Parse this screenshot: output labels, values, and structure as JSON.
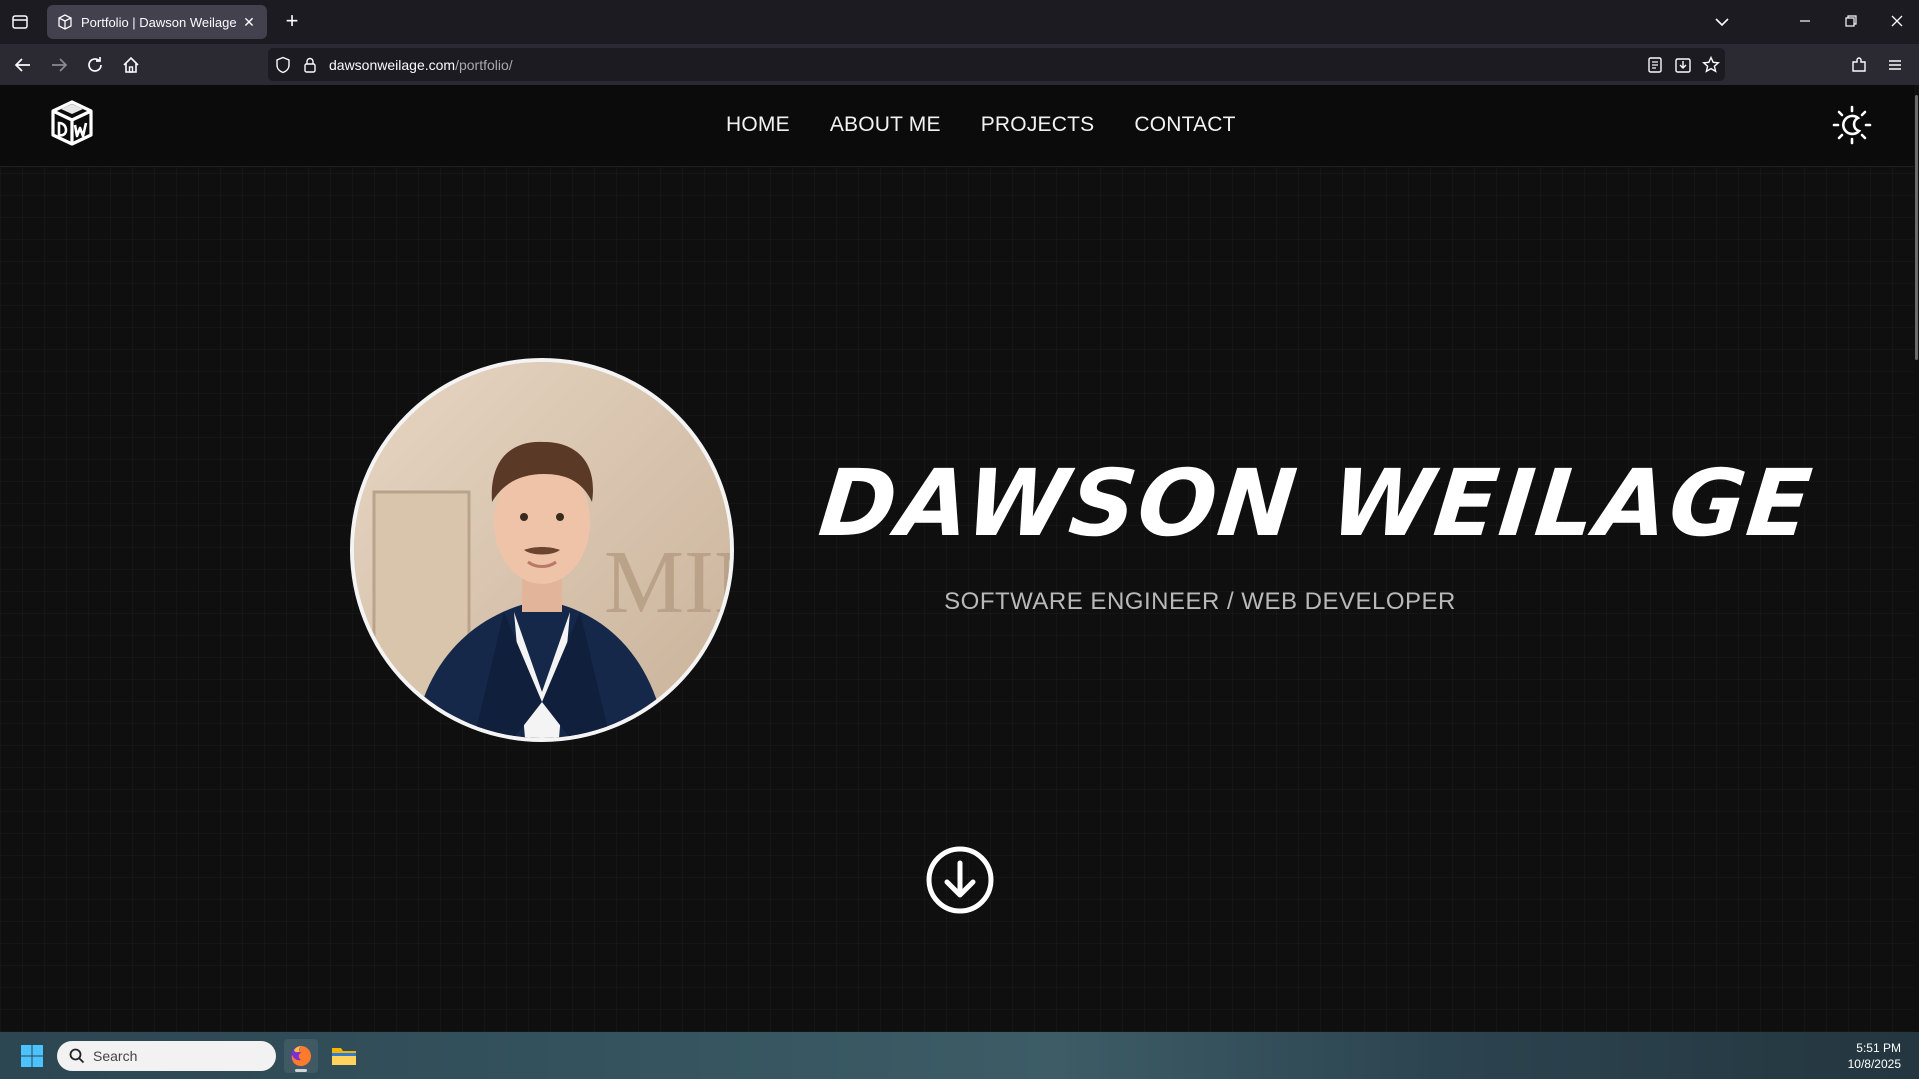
{
  "browser": {
    "tab_title": "Portfolio | Dawson Weilage",
    "url_domain": "dawsonweilage.com",
    "url_path": "/portfolio/"
  },
  "site": {
    "nav": [
      "HOME",
      "ABOUT ME",
      "PROJECTS",
      "CONTACT"
    ],
    "hero_name": "DAWSON WEILAGE",
    "hero_role": "SOFTWARE ENGINEER / WEB DEVELOPER"
  },
  "taskbar": {
    "search_placeholder": "Search",
    "time": "5:51 PM",
    "date": "10/8/2025"
  },
  "icons": {
    "logo": "dw-cube-logo-icon",
    "theme": "sun-moon-icon",
    "scroll": "arrow-down-circle-icon"
  },
  "colors": {
    "page_bg": "#0f0f10",
    "header_bg": "#0b0b0c",
    "text": "#ffffff",
    "subtitle": "#b9b9b9"
  }
}
